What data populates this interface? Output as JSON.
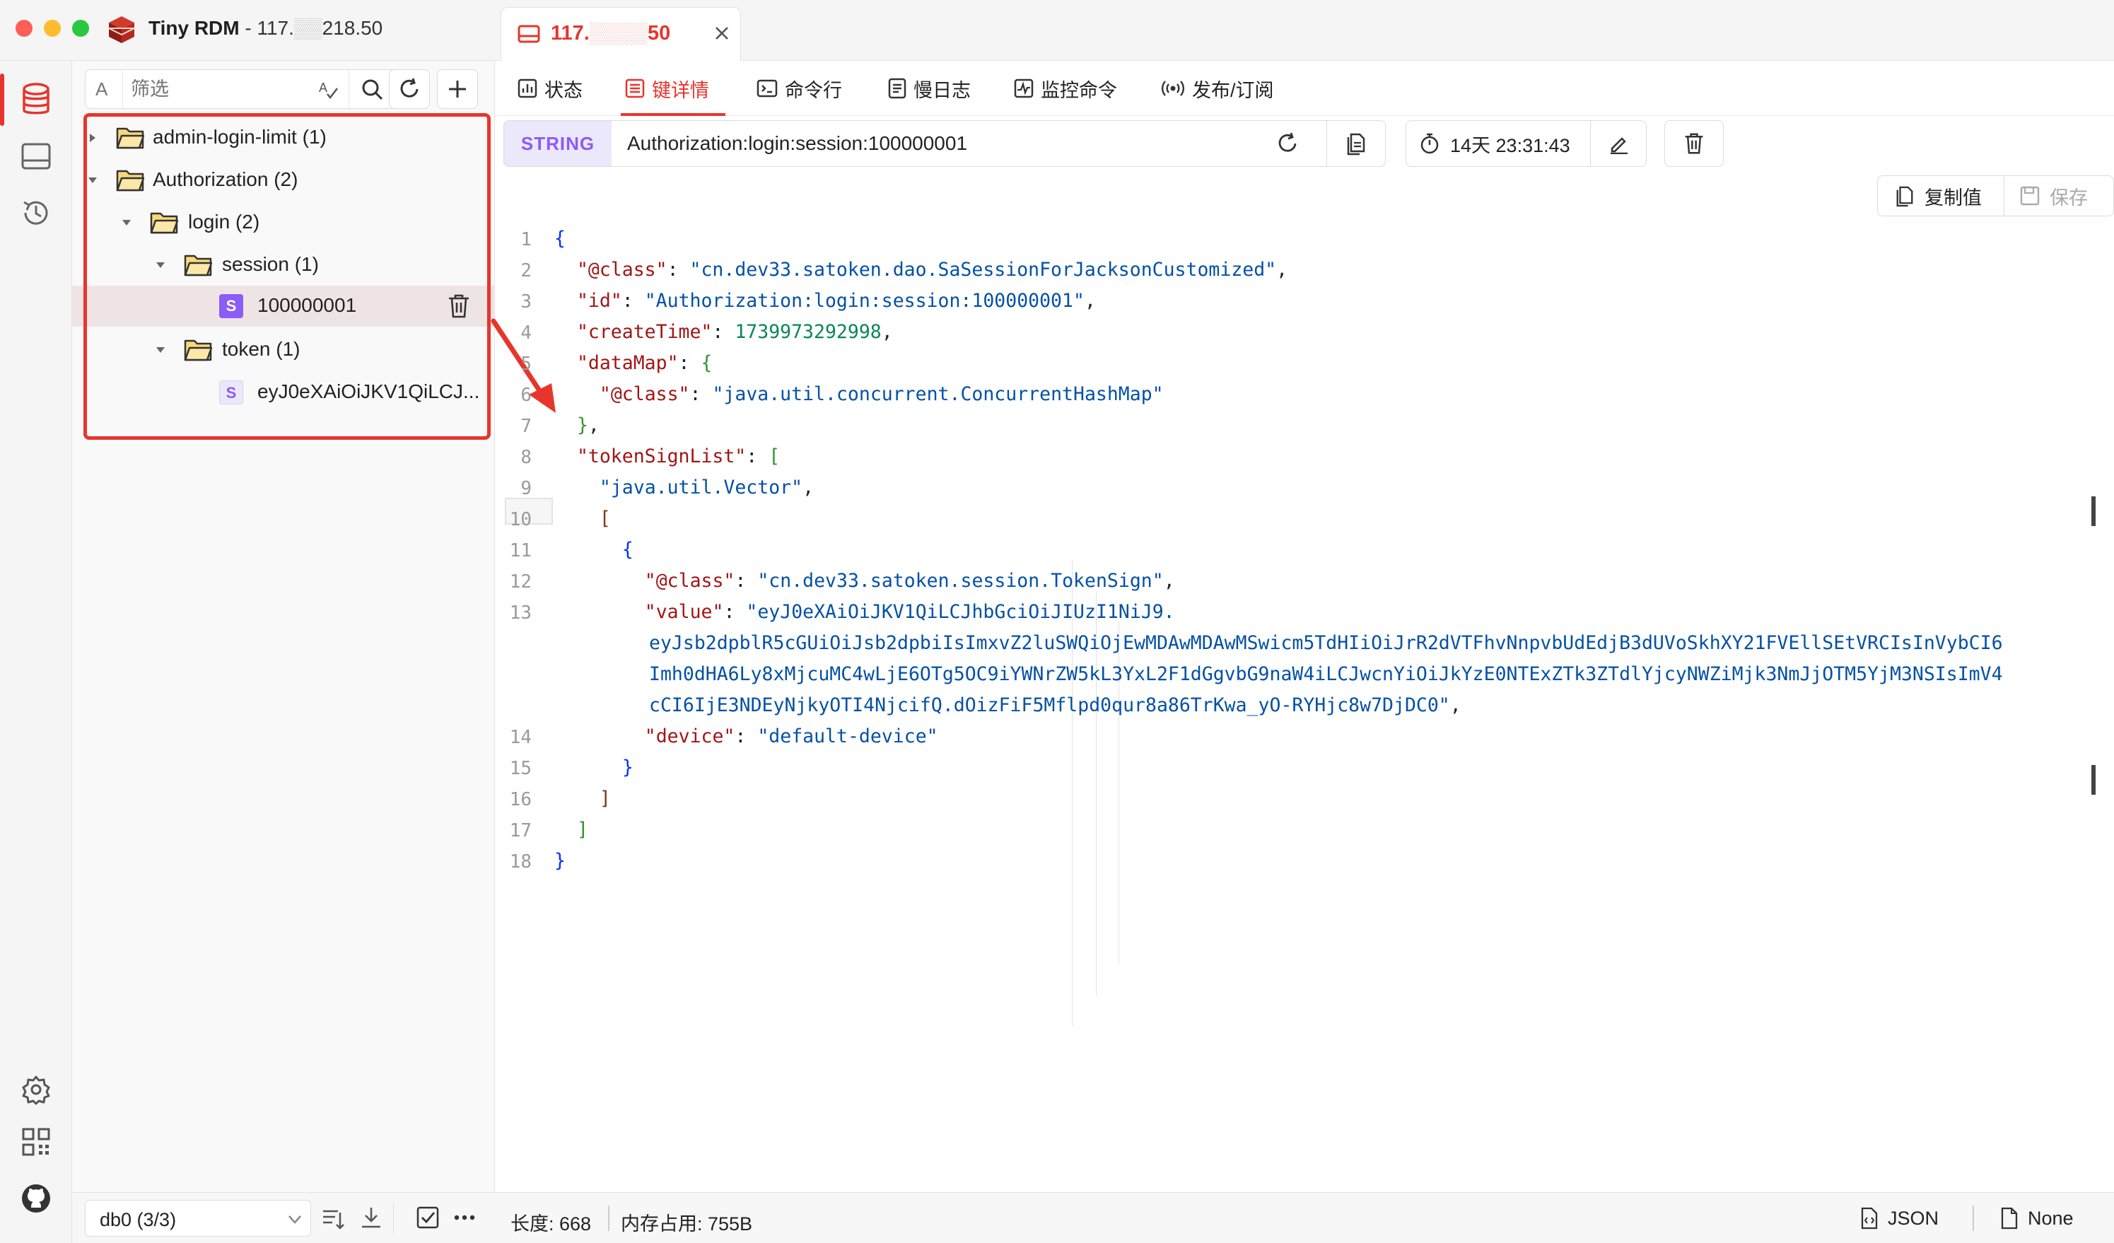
{
  "window": {
    "app_name": "Tiny RDM",
    "host": " - 117.",
    "host_tail": "218.50"
  },
  "tabs": [
    {
      "label": "117.",
      "label_tail": "50"
    }
  ],
  "sidebar": {
    "filter_prefix": "A",
    "filter_placeholder": "筛选",
    "tree": [
      {
        "label": "admin-login-limit (1)",
        "type": "folder",
        "expanded": false
      },
      {
        "label": "Authorization (2)",
        "type": "folder",
        "expanded": true
      },
      {
        "label": "login (2)",
        "type": "folder",
        "expanded": true
      },
      {
        "label": "session (1)",
        "type": "folder",
        "expanded": true
      },
      {
        "label": "100000001",
        "type": "key",
        "badge": "S",
        "selected": true
      },
      {
        "label": "token (1)",
        "type": "folder",
        "expanded": true
      },
      {
        "label": "eyJ0eXAiOiJKV1QiLCJ...",
        "type": "key",
        "badge": "S",
        "selected": false
      }
    ],
    "db_select": "db0 (3/3)"
  },
  "subtabs": [
    {
      "label": "状态",
      "icon": "chart-icon",
      "active": false
    },
    {
      "label": "键详情",
      "icon": "list-icon",
      "active": true
    },
    {
      "label": "命令行",
      "icon": "terminal-icon",
      "active": false
    },
    {
      "label": "慢日志",
      "icon": "log-icon",
      "active": false
    },
    {
      "label": "监控命令",
      "icon": "monitor-icon",
      "active": false
    },
    {
      "label": "发布/订阅",
      "icon": "broadcast-icon",
      "active": false
    }
  ],
  "key": {
    "type": "STRING",
    "name": "Authorization:login:session:100000001",
    "ttl": "14天 23:31:43",
    "copy_label": "复制值",
    "save_label": "保存"
  },
  "editor": {
    "lines": [
      {
        "n": "1",
        "t": "{"
      },
      {
        "n": "2",
        "t": "  \"@class\": \"cn.dev33.satoken.dao.SaSessionForJacksonCustomized\","
      },
      {
        "n": "3",
        "t": "  \"id\": \"Authorization:login:session:100000001\","
      },
      {
        "n": "4",
        "t": "  \"createTime\": 1739973292998,"
      },
      {
        "n": "5",
        "t": "  \"dataMap\": {"
      },
      {
        "n": "6",
        "t": "    \"@class\": \"java.util.concurrent.ConcurrentHashMap\""
      },
      {
        "n": "7",
        "t": "  },"
      },
      {
        "n": "8",
        "t": "  \"tokenSignList\": ["
      },
      {
        "n": "9",
        "t": "    \"java.util.Vector\","
      },
      {
        "n": "10",
        "t": "    ["
      },
      {
        "n": "11",
        "t": "      {"
      },
      {
        "n": "12",
        "t": "        \"@class\": \"cn.dev33.satoken.session.TokenSign\","
      },
      {
        "n": "13",
        "t": "        \"value\": \"eyJ0eXAiOiJKV1QiLCJhbGciOiJIUzI1NiJ9."
      },
      {
        "n": "",
        "t": "eyJsb2dpblR5cGUiOiJsb2dpbiIsImxvZ2luSWQiOjEwMDAwMDAwMSwicm5TdHIiOiJrR2dVTFhvNnpvbUdEdjB3dUVoSkhXY21FVEllSEtVRCIsInVybCI6"
      },
      {
        "n": "",
        "t": "Imh0dHA6Ly8xMjcuMC4wLjE6OTg5OC9iYWNrZW5kL3YxL2F1dGgvbG9naW4iLCJwcnYiOiJkYzE0NTExZTk3ZTdlYjcyNWZiMjk3NmJjOTM5YjM3NSIsImV4"
      },
      {
        "n": "",
        "t": "cCI6IjE3NDEyNjkyOTI4NjcifQ.dOizFiF5Mflpd0qur8a86TrKwa_yO-RYHjc8w7DjDC0\","
      },
      {
        "n": "14",
        "t": "        \"device\": \"default-device\""
      },
      {
        "n": "15",
        "t": "      }"
      },
      {
        "n": "16",
        "t": "    ]"
      },
      {
        "n": "17",
        "t": "  ]"
      },
      {
        "n": "18",
        "t": "}"
      }
    ]
  },
  "status": {
    "length": "长度: 668",
    "memory": "内存占用: 755B",
    "format": "JSON",
    "decode": "None"
  },
  "colors": {
    "accent": "#e8352c",
    "highlight": "#e8352c",
    "badge": "#8b5cf6",
    "string_badge_bg": "#e9e6f7"
  }
}
